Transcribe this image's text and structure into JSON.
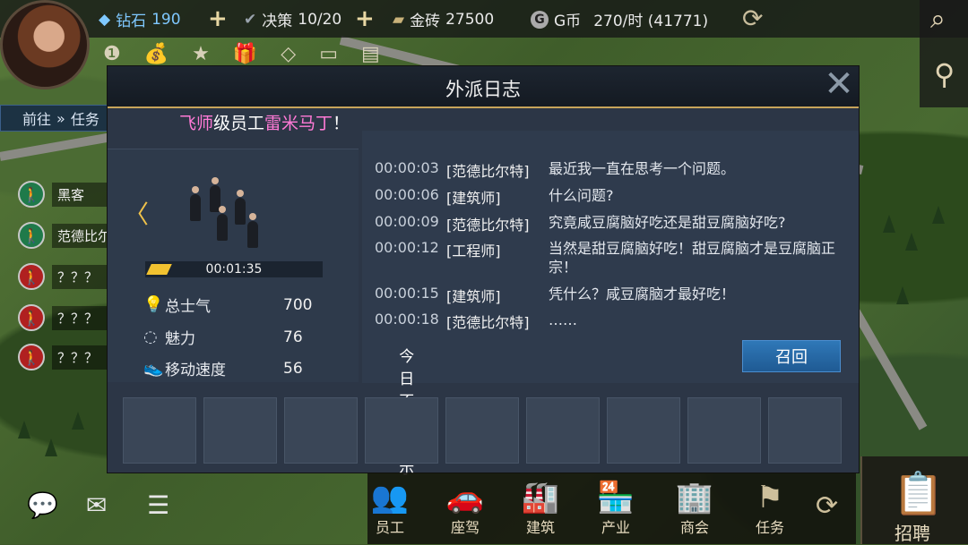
{
  "topbar": {
    "diamond": {
      "label": "钻石",
      "value": "190"
    },
    "decision": {
      "label": "决策",
      "value": "10/20"
    },
    "gold_brick": {
      "label": "金砖",
      "value": "27500"
    },
    "gcoin": {
      "label": "G币",
      "value": "270/时 (41771)"
    }
  },
  "left_panel": {
    "goto_label": "前往",
    "task_label": "任务",
    "agents": [
      "黑客",
      "范德比尔",
      "？？？",
      "？？？",
      "？？？"
    ]
  },
  "dialog": {
    "title": "外派日志",
    "ticker": {
      "part1": "飞师",
      "part2": "级员工",
      "name": "雷米马丁",
      "end": "！"
    },
    "timer": "00:01:35",
    "progress": 0.12,
    "stats": [
      {
        "label": "总士气",
        "value": "700"
      },
      {
        "label": "魅力",
        "value": "76"
      },
      {
        "label": "移动速度",
        "value": "56"
      }
    ],
    "log": [
      {
        "time": "00:00:03",
        "role": "[范德比尔特]",
        "msg": "最近我一直在思考一个问题。"
      },
      {
        "time": "00:00:06",
        "role": "[建筑师]",
        "msg": "什么问题?"
      },
      {
        "time": "00:00:09",
        "role": "[范德比尔特]",
        "msg": "究竟咸豆腐脑好吃还是甜豆腐脑好吃?"
      },
      {
        "time": "00:00:12",
        "role": "[工程师]",
        "msg": "当然是甜豆腐脑好吃！甜豆腐脑才是豆腐脑正宗！"
      },
      {
        "time": "00:00:15",
        "role": "[建筑师]",
        "msg": "凭什么？咸豆腐脑才最好吃！"
      },
      {
        "time": "00:00:18",
        "role": "[范德比尔特]",
        "msg": "……"
      }
    ],
    "checkbox_label": "今日不再提示",
    "recall_label": "召回"
  },
  "bottom_nav": [
    "员工",
    "座驾",
    "建筑",
    "产业",
    "商会",
    "任务"
  ],
  "recruit_label": "招聘"
}
